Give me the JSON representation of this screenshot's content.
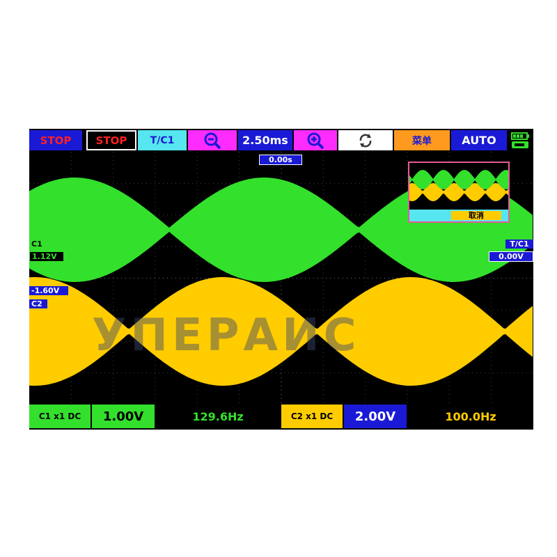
{
  "topbar": {
    "run_state": "STOP",
    "run_button": "STOP",
    "trigger_source": "T/C1",
    "zoom_out_icon": "zoom-out-icon",
    "timebase": "2.50ms",
    "zoom_in_icon": "zoom-in-icon",
    "refresh_icon": "refresh-icon",
    "menu": "菜单",
    "auto": "AUTO",
    "battery_icon": "battery-icon"
  },
  "trigger_position": "0.00s",
  "overview": {
    "cancel": "取消"
  },
  "markers": {
    "c1": "C1",
    "c1_offset": "1.12V",
    "c2_offset": "-1.60V",
    "c2": "C2",
    "trigger_label": "T/C1",
    "trigger_level": "0.00V"
  },
  "watermark": "УПЕРАИС",
  "bottombar": {
    "c1_coupling": "C1 x1 DC",
    "c1_scale": "1.00V",
    "c1_freq": "129.6Hz",
    "c2_coupling": "C2 x1 DC",
    "c2_scale": "2.00V",
    "c2_freq": "100.0Hz"
  },
  "colors": {
    "c1": "#33e02c",
    "c2": "#ffcc00",
    "accent_blue": "#1a1ad6",
    "accent_cyan": "#56e6f0",
    "accent_magenta": "#ff2cff",
    "accent_orange": "#ff9a1e"
  }
}
